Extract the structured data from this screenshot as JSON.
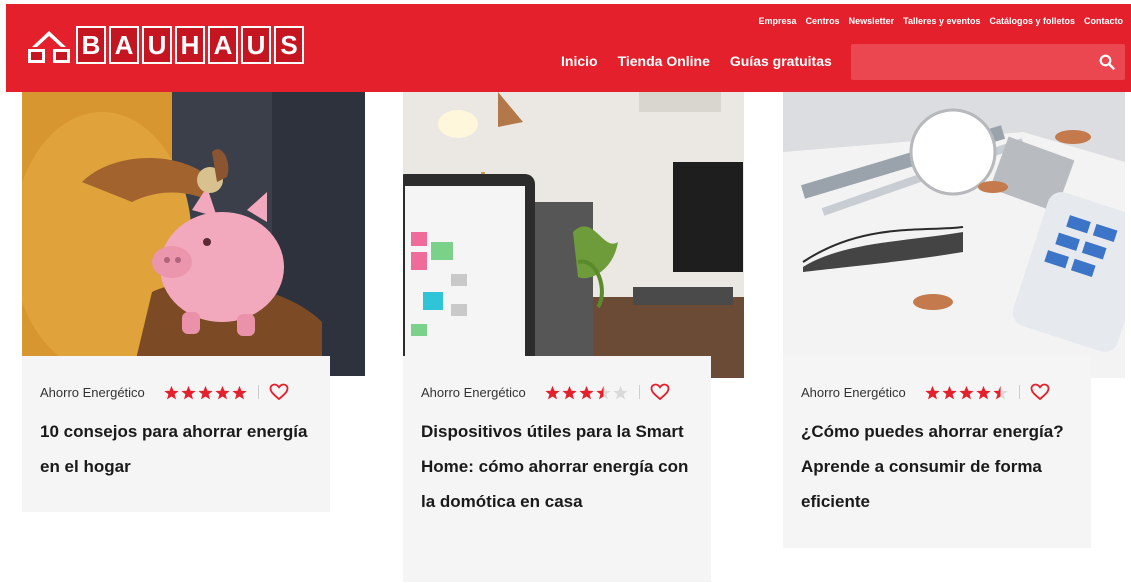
{
  "brand": {
    "name": "BAUHAUS",
    "letters": [
      "B",
      "A",
      "U",
      "H",
      "A",
      "U",
      "S"
    ],
    "color": "#e3202b"
  },
  "top_links": [
    "Empresa",
    "Centros",
    "Newsletter",
    "Talleres y eventos",
    "Catálogos y folletos",
    "Contacto"
  ],
  "main_nav": [
    "Inicio",
    "Tienda Online",
    "Guías gratuitas"
  ],
  "search": {
    "value": "",
    "placeholder": "",
    "icon": "search-icon"
  },
  "cards": [
    {
      "category": "Ahorro Energético",
      "rating": 5,
      "title": "10 consejos para ahorrar energía en el hogar",
      "image": "piggy-bank-photo"
    },
    {
      "category": "Ahorro Energético",
      "rating": 3.5,
      "title": "Dispositivos útiles para la Smart Home: cómo ahorrar energía con la domótica en casa",
      "image": "smart-home-tablet-photo"
    },
    {
      "category": "Ahorro Energético",
      "rating": 4.5,
      "title": "¿Cómo puedes ahorrar energía? Aprende a consumir de forma eficiente",
      "image": "lightbulb-calculator-photo"
    }
  ],
  "colors": {
    "accent": "#e3202b",
    "star_empty": "#d9d9d9",
    "card_bg": "#f5f5f5"
  }
}
